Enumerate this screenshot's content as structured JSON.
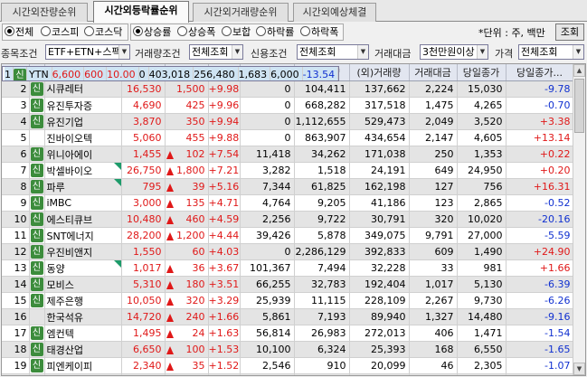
{
  "tabs": [
    "시간외잔량순위",
    "시간외등락률순위",
    "시간외거래량순위",
    "시간외예상체결"
  ],
  "active_tab": 1,
  "market_radios": [
    {
      "label": "전체",
      "checked": true
    },
    {
      "label": "코스피",
      "checked": false
    },
    {
      "label": "코스닥",
      "checked": false
    }
  ],
  "direction_radios": [
    {
      "label": "상승률",
      "checked": true
    },
    {
      "label": "상승폭",
      "checked": false
    },
    {
      "label": "보합",
      "checked": false
    },
    {
      "label": "하락률",
      "checked": false
    },
    {
      "label": "하락폭",
      "checked": false
    }
  ],
  "unit_text": "*단위 : 주, 백만",
  "query_button": "조회",
  "filters": {
    "item_label": "종목조건",
    "item_value": "ETF+ETN+스팩",
    "volume_label": "거래량조건",
    "volume_value": "전체조회",
    "credit_label": "신용조건",
    "credit_value": "전체조회",
    "amount_label": "거래대금",
    "amount_value": "3천만원이상",
    "price_label": "가격",
    "price_value": "전체조회"
  },
  "columns": [
    "...",
    "",
    "종목명",
    "현재가",
    "전일...",
    "등...",
    "매도잔량",
    "매수잔량",
    "(외)거래량",
    "거래대금",
    "당일종가",
    "당일종가..."
  ],
  "rows": [
    {
      "rank": "1",
      "icon": "신",
      "name": "YTN",
      "flag": false,
      "price": "6,600",
      "tri": false,
      "diff": "600",
      "rate": "10.00",
      "sell": "0",
      "buy": "403,018",
      "vol": "256,480",
      "amt": "1,683",
      "close": "6,000",
      "close_rate": "-13.54",
      "cr_color": "blue",
      "selected": true
    },
    {
      "rank": "2",
      "icon": "신",
      "name": "시큐레터",
      "flag": false,
      "price": "16,530",
      "tri": false,
      "diff": "1,500",
      "rate": "+9.98",
      "sell": "0",
      "buy": "104,411",
      "vol": "137,662",
      "amt": "2,224",
      "close": "15,030",
      "close_rate": "-9.78",
      "cr_color": "blue"
    },
    {
      "rank": "3",
      "icon": "신",
      "name": "유진투자증",
      "flag": false,
      "price": "4,690",
      "tri": false,
      "diff": "425",
      "rate": "+9.96",
      "sell": "0",
      "buy": "668,282",
      "vol": "317,518",
      "amt": "1,475",
      "close": "4,265",
      "close_rate": "-0.70",
      "cr_color": "blue"
    },
    {
      "rank": "4",
      "icon": "신",
      "name": "유진기업",
      "flag": false,
      "price": "3,870",
      "tri": false,
      "diff": "350",
      "rate": "+9.94",
      "sell": "0",
      "buy": "1,112,655",
      "vol": "529,473",
      "amt": "2,049",
      "close": "3,520",
      "close_rate": "+3.38",
      "cr_color": "red"
    },
    {
      "rank": "5",
      "icon": "",
      "name": "진바이오텍",
      "flag": false,
      "price": "5,060",
      "tri": false,
      "diff": "455",
      "rate": "+9.88",
      "sell": "0",
      "buy": "863,907",
      "vol": "434,654",
      "amt": "2,147",
      "close": "4,605",
      "close_rate": "+13.14",
      "cr_color": "red"
    },
    {
      "rank": "6",
      "icon": "신",
      "name": "위니아에이",
      "flag": false,
      "price": "1,455",
      "tri": true,
      "diff": "102",
      "rate": "+7.54",
      "sell": "11,418",
      "buy": "34,262",
      "vol": "171,038",
      "amt": "250",
      "close": "1,353",
      "close_rate": "+0.22",
      "cr_color": "red"
    },
    {
      "rank": "7",
      "icon": "신",
      "name": "박셀바이오",
      "flag": true,
      "price": "26,750",
      "tri": true,
      "diff": "1,800",
      "rate": "+7.21",
      "sell": "3,282",
      "buy": "1,518",
      "vol": "24,191",
      "amt": "649",
      "close": "24,950",
      "close_rate": "+0.20",
      "cr_color": "red"
    },
    {
      "rank": "8",
      "icon": "신",
      "name": "파루",
      "flag": true,
      "price": "795",
      "tri": true,
      "diff": "39",
      "rate": "+5.16",
      "sell": "7,344",
      "buy": "61,825",
      "vol": "162,198",
      "amt": "127",
      "close": "756",
      "close_rate": "+16.31",
      "cr_color": "red"
    },
    {
      "rank": "9",
      "icon": "신",
      "name": "iMBC",
      "flag": false,
      "price": "3,000",
      "tri": true,
      "diff": "135",
      "rate": "+4.71",
      "sell": "4,764",
      "buy": "9,205",
      "vol": "41,186",
      "amt": "123",
      "close": "2,865",
      "close_rate": "-0.52",
      "cr_color": "blue"
    },
    {
      "rank": "10",
      "icon": "신",
      "name": "에스티큐브",
      "flag": false,
      "price": "10,480",
      "tri": true,
      "diff": "460",
      "rate": "+4.59",
      "sell": "2,256",
      "buy": "9,722",
      "vol": "30,791",
      "amt": "320",
      "close": "10,020",
      "close_rate": "-20.16",
      "cr_color": "blue"
    },
    {
      "rank": "11",
      "icon": "신",
      "name": "SNT에너지",
      "flag": false,
      "price": "28,200",
      "tri": true,
      "diff": "1,200",
      "rate": "+4.44",
      "sell": "39,426",
      "buy": "5,878",
      "vol": "349,075",
      "amt": "9,791",
      "close": "27,000",
      "close_rate": "-5.59",
      "cr_color": "blue"
    },
    {
      "rank": "12",
      "icon": "신",
      "name": "우진비앤지",
      "flag": false,
      "price": "1,550",
      "tri": false,
      "diff": "60",
      "rate": "+4.03",
      "sell": "0",
      "buy": "2,286,129",
      "vol": "392,833",
      "amt": "609",
      "close": "1,490",
      "close_rate": "+24.90",
      "cr_color": "red"
    },
    {
      "rank": "13",
      "icon": "신",
      "name": "동양",
      "flag": true,
      "price": "1,017",
      "tri": true,
      "diff": "36",
      "rate": "+3.67",
      "sell": "101,367",
      "buy": "7,494",
      "vol": "32,228",
      "amt": "33",
      "close": "981",
      "close_rate": "+1.66",
      "cr_color": "red"
    },
    {
      "rank": "14",
      "icon": "신",
      "name": "모비스",
      "flag": false,
      "price": "5,310",
      "tri": true,
      "diff": "180",
      "rate": "+3.51",
      "sell": "66,255",
      "buy": "32,783",
      "vol": "192,404",
      "amt": "1,017",
      "close": "5,130",
      "close_rate": "-6.39",
      "cr_color": "blue"
    },
    {
      "rank": "15",
      "icon": "신",
      "name": "제주은행",
      "flag": false,
      "price": "10,050",
      "tri": true,
      "diff": "320",
      "rate": "+3.29",
      "sell": "25,939",
      "buy": "11,115",
      "vol": "228,109",
      "amt": "2,267",
      "close": "9,730",
      "close_rate": "-6.26",
      "cr_color": "blue"
    },
    {
      "rank": "16",
      "icon": "",
      "name": "한국석유",
      "flag": false,
      "price": "14,720",
      "tri": true,
      "diff": "240",
      "rate": "+1.66",
      "sell": "5,861",
      "buy": "7,193",
      "vol": "89,940",
      "amt": "1,327",
      "close": "14,480",
      "close_rate": "-9.16",
      "cr_color": "blue"
    },
    {
      "rank": "17",
      "icon": "신",
      "name": "엠컨텍",
      "flag": false,
      "price": "1,495",
      "tri": true,
      "diff": "24",
      "rate": "+1.63",
      "sell": "56,814",
      "buy": "26,983",
      "vol": "272,013",
      "amt": "406",
      "close": "1,471",
      "close_rate": "-1.54",
      "cr_color": "blue"
    },
    {
      "rank": "18",
      "icon": "신",
      "name": "태경산업",
      "flag": false,
      "price": "6,650",
      "tri": true,
      "diff": "100",
      "rate": "+1.53",
      "sell": "10,100",
      "buy": "6,324",
      "vol": "25,393",
      "amt": "168",
      "close": "6,550",
      "close_rate": "-1.65",
      "cr_color": "blue"
    },
    {
      "rank": "19",
      "icon": "신",
      "name": "피엔케이피",
      "flag": false,
      "price": "2,340",
      "tri": true,
      "diff": "35",
      "rate": "+1.52",
      "sell": "2,546",
      "buy": "910",
      "vol": "20,099",
      "amt": "46",
      "close": "2,305",
      "close_rate": "-1.07",
      "cr_color": "blue"
    },
    {
      "rank": "20",
      "icon": "신",
      "name": "코센",
      "flag": false,
      "price": "4,840",
      "tri": true,
      "diff": "70",
      "rate": "+1.47",
      "sell": "9,065",
      "buy": "8,665",
      "vol": "11,429",
      "amt": "55",
      "close": "4,770",
      "close_rate": "+3.58",
      "cr_color": "red"
    }
  ]
}
